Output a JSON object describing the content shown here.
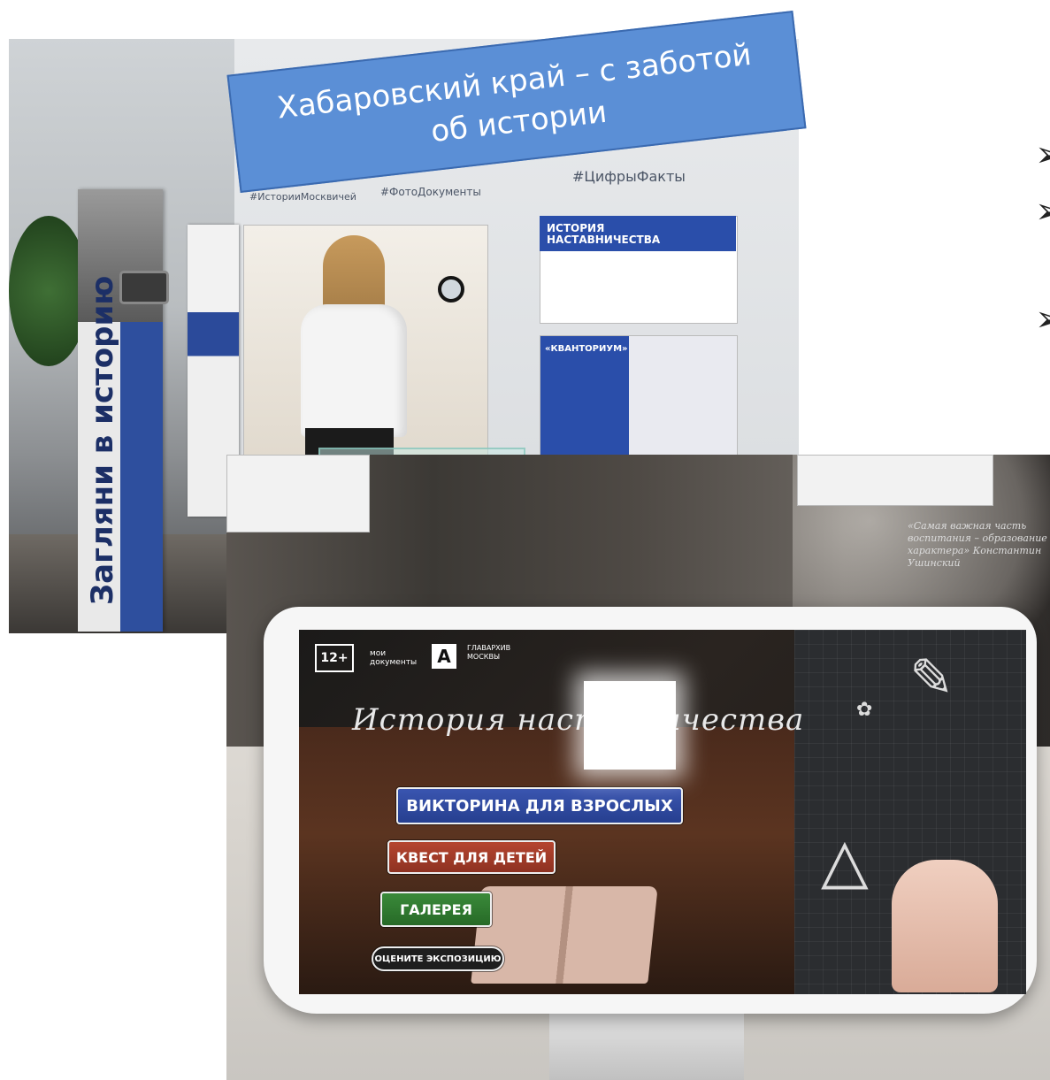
{
  "banner": {
    "title": "Хабаровский край – с заботой об истории"
  },
  "hall_photo": {
    "hashtags": [
      "#ИсторииМосквичей",
      "#ФотоДокументы",
      "#ЦифрыФакты"
    ],
    "pillar_text": "Загляни в историю",
    "panel_title": "ИСТОРИЯ НАСТАВНИЧЕСТВА",
    "panel_sub": "«КВАНТОРИУМ»"
  },
  "bullets": [
    "➢",
    "➢",
    "➢"
  ],
  "kiosk": {
    "age_rating": "12+",
    "logo_docs": "мои документы",
    "logo_a": "А",
    "logo_archive": "ГЛАВАРХИВ МОСКВЫ",
    "screen_title": "История наставничества",
    "buttons": {
      "adult_quiz": "ВИКТОРИНА ДЛЯ ВЗРОСЛЫХ",
      "kids_quest": "КВЕСТ ДЛЯ ДЕТЕЙ",
      "gallery": "ГАЛЕРЕЯ",
      "rate": "ОЦЕНИТЕ ЭКСПОЗИЦИЮ"
    },
    "mural_quote": "«Самая важная часть воспитания – образование характера» Константин Ушинский"
  },
  "colors": {
    "banner_bg": "#5b8fd6",
    "adult_button": "#3a55b0",
    "kids_button": "#b5452f",
    "gallery_button": "#3a8a3a"
  }
}
